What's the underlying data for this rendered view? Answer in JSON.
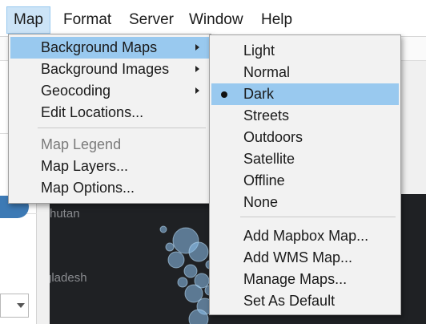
{
  "menubar": {
    "items": [
      {
        "label": "Map",
        "active": true
      },
      {
        "label": "Format",
        "active": false
      },
      {
        "label": "Server",
        "active": false
      },
      {
        "label": "Window",
        "active": false
      },
      {
        "label": "Help",
        "active": false
      }
    ]
  },
  "map_menu": {
    "items": [
      {
        "label": "Background Maps",
        "submenu": true
      },
      {
        "label": "Background Images",
        "submenu": true
      },
      {
        "label": "Geocoding",
        "submenu": true
      },
      {
        "label": "Edit Locations..."
      },
      {
        "label": "Map Legend",
        "disabled": true
      },
      {
        "label": "Map Layers..."
      },
      {
        "label": "Map Options..."
      }
    ]
  },
  "background_maps_menu": {
    "items": [
      {
        "label": "Light"
      },
      {
        "label": "Normal"
      },
      {
        "label": "Dark",
        "selected": true
      },
      {
        "label": "Streets"
      },
      {
        "label": "Outdoors"
      },
      {
        "label": "Satellite"
      },
      {
        "label": "Offline"
      },
      {
        "label": "None"
      },
      {
        "label": "Add Mapbox Map..."
      },
      {
        "label": "Add WMS Map..."
      },
      {
        "label": "Manage Maps..."
      },
      {
        "label": "Set As Default"
      }
    ]
  },
  "map_view": {
    "labels": [
      "hutan",
      "gladesh"
    ]
  },
  "colors": {
    "highlight": "#99c9ef",
    "menubar_active": "#cce4f7",
    "map_background": "#1f2124",
    "bubble": "#8ec3ee"
  }
}
